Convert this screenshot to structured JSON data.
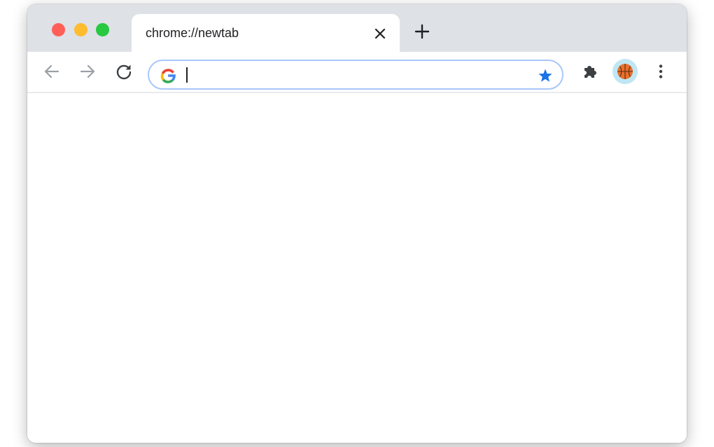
{
  "window": {
    "traffic_lights": {
      "close_color": "#ff5f57",
      "minimize_color": "#febc2e",
      "maximize_color": "#28c840"
    }
  },
  "tabs": [
    {
      "title": "chrome://newtab",
      "active": true,
      "close_icon": "close-icon"
    }
  ],
  "tabstrip": {
    "new_tab_icon": "plus-icon"
  },
  "toolbar": {
    "back_icon": "arrow-left-icon",
    "forward_icon": "arrow-right-icon",
    "reload_icon": "reload-icon",
    "omnibox": {
      "value": "",
      "search_engine_icon": "google-g-icon",
      "bookmark_icon": "star-icon",
      "bookmark_color": "#1a73e8",
      "border_color": "#a8c7fa"
    },
    "extensions_icon": "puzzle-icon",
    "profile_icon": "basketball-icon",
    "profile_bg": "#bfe6f3",
    "menu_icon": "kebab-menu-icon"
  },
  "colors": {
    "titlebar_bg": "#dee1e6",
    "disabled_icon": "#9aa0a6",
    "enabled_icon": "#3c4043"
  }
}
